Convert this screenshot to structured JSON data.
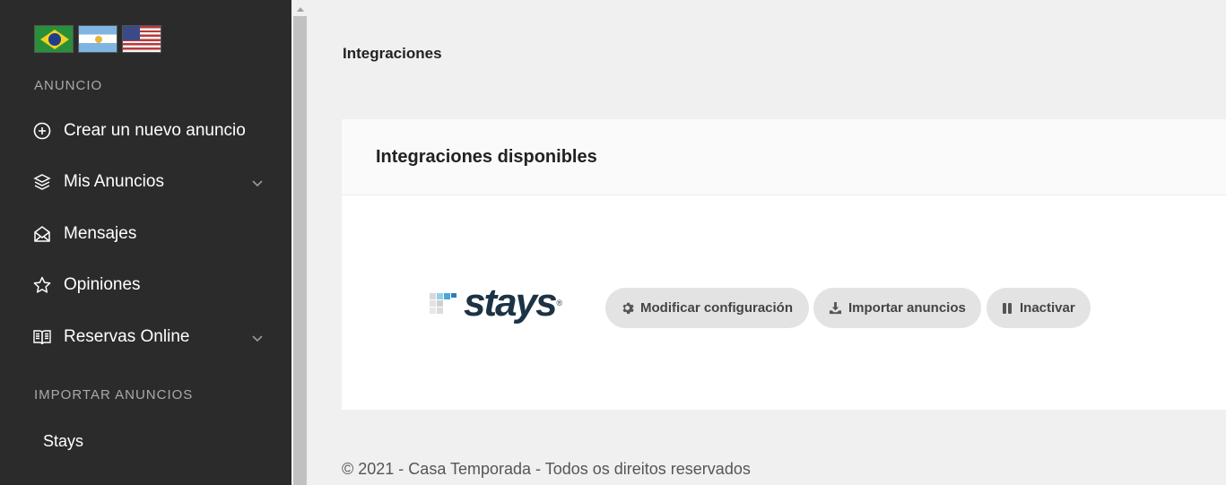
{
  "sidebar": {
    "flags": [
      {
        "name": "brazil-flag-icon"
      },
      {
        "name": "argentina-flag-icon"
      },
      {
        "name": "usa-flag-icon"
      }
    ],
    "section_anuncio": "ANUNCIO",
    "items": [
      {
        "label": "Crear un nuevo anuncio",
        "icon": "plus-circle-icon"
      },
      {
        "label": "Mis Anuncios",
        "icon": "layers-icon",
        "expandable": true
      },
      {
        "label": "Mensajes",
        "icon": "envelope-open-icon"
      },
      {
        "label": "Opiniones",
        "icon": "star-icon"
      },
      {
        "label": "Reservas Online",
        "icon": "book-icon",
        "expandable": true
      }
    ],
    "section_importar": "IMPORTAR ANUNCIOS",
    "sub_items": [
      {
        "label": "Stays"
      }
    ]
  },
  "main": {
    "page_title": "Integraciones",
    "card": {
      "title": "Integraciones disponibles",
      "integration": {
        "logo_text": "stays",
        "logo_mark": "®",
        "buttons": {
          "configure": "Modificar configuración",
          "import": "Importar anuncios",
          "deactivate": "Inactivar"
        }
      }
    },
    "footer": "© 2021 - Casa Temporada - Todos os direitos reservados"
  },
  "colors": {
    "sidebar_bg": "#2b2b2b",
    "page_bg": "#f0f0f0",
    "button_bg": "#e3e3e3",
    "logo": "#1c3346"
  }
}
